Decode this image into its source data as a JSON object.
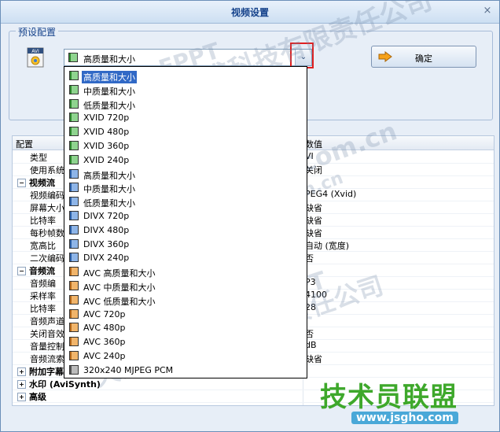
{
  "window": {
    "title": "视频设置",
    "close_glyph": "×"
  },
  "preset_group": {
    "label": "预设配置",
    "icon_badge": "AVI"
  },
  "combo": {
    "selected": "高质量和大小",
    "arrow_glyph": "⌄"
  },
  "ok_button": {
    "label": "确定"
  },
  "grid": {
    "headers": [
      "配置",
      "数值"
    ],
    "rows": [
      {
        "name": "类型",
        "value": "VI"
      },
      {
        "name": "使用系统解",
        "value": "关闭"
      },
      {
        "name": "视频流",
        "value": "",
        "toggle": "−"
      },
      {
        "name": "视频编码",
        "value": "PEG4 (Xvid)"
      },
      {
        "name": "屏幕大小",
        "value": "缺省"
      },
      {
        "name": "比特率",
        "value": "缺省"
      },
      {
        "name": "每秒帧数",
        "value": "缺省"
      },
      {
        "name": "宽高比",
        "value": "自动 (宽度)"
      },
      {
        "name": "二次编码",
        "value": "否"
      },
      {
        "name": "音频流",
        "value": "",
        "toggle": "−"
      },
      {
        "name": "音频编",
        "value": "P3"
      },
      {
        "name": "采样率",
        "value": "4100"
      },
      {
        "name": "比特率",
        "value": "28"
      },
      {
        "name": "音频声道",
        "value": ""
      },
      {
        "name": "关闭音效",
        "value": "否"
      },
      {
        "name": "音量控制",
        "value": "dB"
      },
      {
        "name": "音频流索",
        "value": "缺省"
      },
      {
        "name": "附加字幕",
        "value": "",
        "toggle": "+"
      },
      {
        "name": "水印 (AviSynth)",
        "value": "",
        "toggle": "+"
      },
      {
        "name": "高级",
        "value": "",
        "toggle": "+"
      }
    ]
  },
  "dropdown": {
    "options": [
      {
        "label": "高质量和大小",
        "icon": "green"
      },
      {
        "label": "中质量和大小",
        "icon": "green"
      },
      {
        "label": "低质量和大小",
        "icon": "green"
      },
      {
        "label": "XVID 720p",
        "icon": "green"
      },
      {
        "label": "XVID 480p",
        "icon": "green"
      },
      {
        "label": "XVID 360p",
        "icon": "green"
      },
      {
        "label": "XVID 240p",
        "icon": "green"
      },
      {
        "label": "高质量和大小",
        "icon": "blue"
      },
      {
        "label": "中质量和大小",
        "icon": "blue"
      },
      {
        "label": "低质量和大小",
        "icon": "blue"
      },
      {
        "label": "DIVX 720p",
        "icon": "blue"
      },
      {
        "label": "DIVX 480p",
        "icon": "blue"
      },
      {
        "label": "DIVX 360p",
        "icon": "blue"
      },
      {
        "label": "DIVX 240p",
        "icon": "blue"
      },
      {
        "label": "AVC 高质量和大小",
        "icon": "orange"
      },
      {
        "label": "AVC 中质量和大小",
        "icon": "orange"
      },
      {
        "label": "AVC 低质量和大小",
        "icon": "orange"
      },
      {
        "label": "AVC 720p",
        "icon": "orange"
      },
      {
        "label": "AVC 480p",
        "icon": "orange"
      },
      {
        "label": "AVC 360p",
        "icon": "orange"
      },
      {
        "label": "AVC 240p",
        "icon": "orange"
      },
      {
        "label": "320x240 MJPEG PCM",
        "icon": "gray"
      }
    ],
    "selected_index": 0
  },
  "watermarks": [
    "EPPT",
    "天津图盛科技有限责任公司",
    "www.eppt.com.cn",
    "EPPT",
    "天津图盛科技有限责任公司",
    "www.eppt.com.cn"
  ],
  "brand": {
    "name": "技术员联盟",
    "url": "www.jsgho.com"
  },
  "colors": {
    "accent": "#3169c6",
    "highlight_box": "#e02020",
    "brand_green": "#3ea82b"
  }
}
